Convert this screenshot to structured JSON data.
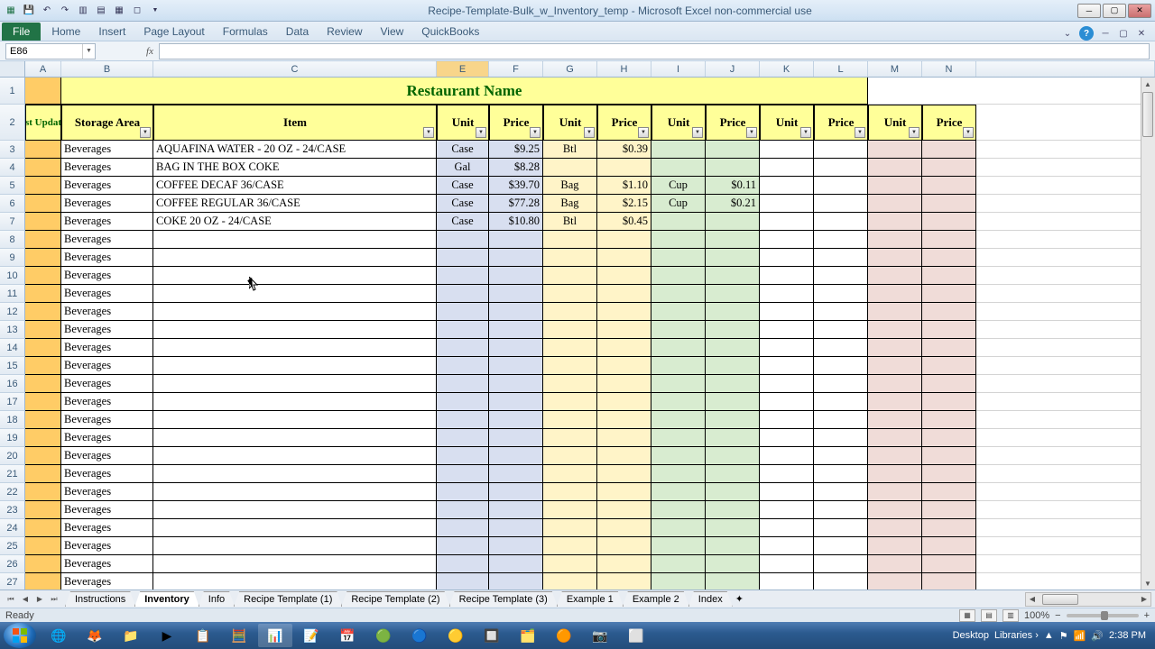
{
  "window": {
    "title": "Recipe-Template-Bulk_w_Inventory_temp - Microsoft Excel non-commercial use"
  },
  "ribbon": {
    "file": "File",
    "tabs": [
      "Home",
      "Insert",
      "Page Layout",
      "Formulas",
      "Data",
      "Review",
      "View",
      "QuickBooks"
    ]
  },
  "nameBox": "E86",
  "formula": "",
  "columns": [
    "A",
    "B",
    "C",
    "E",
    "F",
    "G",
    "H",
    "I",
    "J",
    "K",
    "L",
    "M",
    "N"
  ],
  "selectedCol": "E",
  "titleCell": "Restaurant Name",
  "headers": {
    "a": "Last Update",
    "b": "Storage Area",
    "c": "Item",
    "unit": "Unit",
    "price": "Price"
  },
  "rows": [
    {
      "n": 3,
      "b": "Beverages",
      "c": "AQUAFINA WATER - 20 OZ - 24/CASE",
      "e": "Case",
      "f": "$9.25",
      "g": "Btl",
      "h": "$0.39",
      "i": "",
      "j": ""
    },
    {
      "n": 4,
      "b": "Beverages",
      "c": "BAG IN THE BOX COKE",
      "e": "Gal",
      "f": "$8.28",
      "g": "",
      "h": "",
      "i": "",
      "j": ""
    },
    {
      "n": 5,
      "b": "Beverages",
      "c": "COFFEE DECAF 36/CASE",
      "e": "Case",
      "f": "$39.70",
      "g": "Bag",
      "h": "$1.10",
      "i": "Cup",
      "j": "$0.11"
    },
    {
      "n": 6,
      "b": "Beverages",
      "c": "COFFEE REGULAR 36/CASE",
      "e": "Case",
      "f": "$77.28",
      "g": "Bag",
      "h": "$2.15",
      "i": "Cup",
      "j": "$0.21"
    },
    {
      "n": 7,
      "b": "Beverages",
      "c": "COKE 20 OZ - 24/CASE",
      "e": "Case",
      "f": "$10.80",
      "g": "Btl",
      "h": "$0.45",
      "i": "",
      "j": ""
    },
    {
      "n": 8,
      "b": "Beverages",
      "c": "",
      "e": "",
      "f": "",
      "g": "",
      "h": "",
      "i": "",
      "j": ""
    },
    {
      "n": 9,
      "b": "Beverages",
      "c": "",
      "e": "",
      "f": "",
      "g": "",
      "h": "",
      "i": "",
      "j": ""
    },
    {
      "n": 10,
      "b": "Beverages",
      "c": "",
      "e": "",
      "f": "",
      "g": "",
      "h": "",
      "i": "",
      "j": ""
    },
    {
      "n": 11,
      "b": "Beverages",
      "c": "",
      "e": "",
      "f": "",
      "g": "",
      "h": "",
      "i": "",
      "j": ""
    },
    {
      "n": 12,
      "b": "Beverages",
      "c": "",
      "e": "",
      "f": "",
      "g": "",
      "h": "",
      "i": "",
      "j": ""
    },
    {
      "n": 13,
      "b": "Beverages",
      "c": "",
      "e": "",
      "f": "",
      "g": "",
      "h": "",
      "i": "",
      "j": ""
    },
    {
      "n": 14,
      "b": "Beverages",
      "c": "",
      "e": "",
      "f": "",
      "g": "",
      "h": "",
      "i": "",
      "j": ""
    },
    {
      "n": 15,
      "b": "Beverages",
      "c": "",
      "e": "",
      "f": "",
      "g": "",
      "h": "",
      "i": "",
      "j": ""
    },
    {
      "n": 16,
      "b": "Beverages",
      "c": "",
      "e": "",
      "f": "",
      "g": "",
      "h": "",
      "i": "",
      "j": ""
    },
    {
      "n": 17,
      "b": "Beverages",
      "c": "",
      "e": "",
      "f": "",
      "g": "",
      "h": "",
      "i": "",
      "j": ""
    },
    {
      "n": 18,
      "b": "Beverages",
      "c": "",
      "e": "",
      "f": "",
      "g": "",
      "h": "",
      "i": "",
      "j": ""
    },
    {
      "n": 19,
      "b": "Beverages",
      "c": "",
      "e": "",
      "f": "",
      "g": "",
      "h": "",
      "i": "",
      "j": ""
    },
    {
      "n": 20,
      "b": "Beverages",
      "c": "",
      "e": "",
      "f": "",
      "g": "",
      "h": "",
      "i": "",
      "j": ""
    },
    {
      "n": 21,
      "b": "Beverages",
      "c": "",
      "e": "",
      "f": "",
      "g": "",
      "h": "",
      "i": "",
      "j": ""
    },
    {
      "n": 22,
      "b": "Beverages",
      "c": "",
      "e": "",
      "f": "",
      "g": "",
      "h": "",
      "i": "",
      "j": ""
    },
    {
      "n": 23,
      "b": "Beverages",
      "c": "",
      "e": "",
      "f": "",
      "g": "",
      "h": "",
      "i": "",
      "j": ""
    },
    {
      "n": 24,
      "b": "Beverages",
      "c": "",
      "e": "",
      "f": "",
      "g": "",
      "h": "",
      "i": "",
      "j": ""
    },
    {
      "n": 25,
      "b": "Beverages",
      "c": "",
      "e": "",
      "f": "",
      "g": "",
      "h": "",
      "i": "",
      "j": ""
    },
    {
      "n": 26,
      "b": "Beverages",
      "c": "",
      "e": "",
      "f": "",
      "g": "",
      "h": "",
      "i": "",
      "j": ""
    },
    {
      "n": 27,
      "b": "Beverages",
      "c": "",
      "e": "",
      "f": "",
      "g": "",
      "h": "",
      "i": "",
      "j": ""
    }
  ],
  "sheets": [
    "Instructions",
    "Inventory",
    "Info",
    "Recipe Template (1)",
    "Recipe Template (2)",
    "Recipe Template (3)",
    "Example 1",
    "Example 2",
    "Index"
  ],
  "activeSheet": "Inventory",
  "status": {
    "ready": "Ready",
    "zoom": "100%"
  },
  "tray": {
    "desktop": "Desktop",
    "libraries": "Libraries",
    "time": "2:38 PM"
  }
}
